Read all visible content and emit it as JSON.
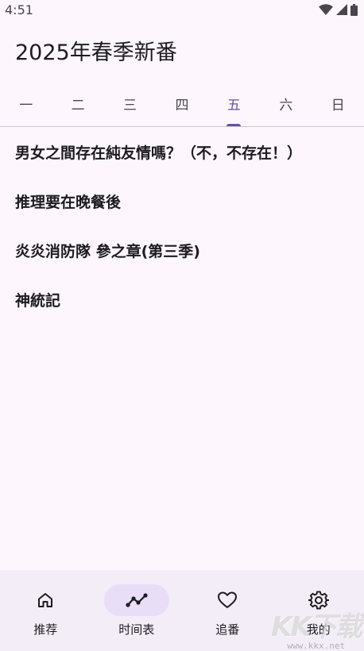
{
  "status_bar": {
    "time": "4:51",
    "icons": [
      "wifi-icon",
      "signal-icon",
      "battery-icon"
    ]
  },
  "app": {
    "title": "2025年春季新番"
  },
  "tabs": [
    {
      "label": "一",
      "active": false
    },
    {
      "label": "二",
      "active": false
    },
    {
      "label": "三",
      "active": false
    },
    {
      "label": "四",
      "active": false
    },
    {
      "label": "五",
      "active": true
    },
    {
      "label": "六",
      "active": false
    },
    {
      "label": "日",
      "active": false
    }
  ],
  "anime_list": [
    {
      "title": "男女之間存在純友情嗎？（不，不存在！）"
    },
    {
      "title": "推理要在晚餐後"
    },
    {
      "title": "炎炎消防隊 參之章(第三季)"
    },
    {
      "title": "神統記"
    }
  ],
  "bottom_nav": [
    {
      "label": "推荐",
      "icon": "home-icon",
      "active": false
    },
    {
      "label": "时间表",
      "icon": "timeline-icon",
      "active": true
    },
    {
      "label": "追番",
      "icon": "heart-icon",
      "active": false
    },
    {
      "label": "我的",
      "icon": "gear-icon",
      "active": false
    }
  ],
  "watermark": {
    "logo": "KK下载",
    "url": "www.kkx.net"
  },
  "colors": {
    "accent": "#6750a4",
    "background": "#fdf7fd",
    "nav_background": "#f3edf7",
    "active_pill": "#e8def8"
  }
}
